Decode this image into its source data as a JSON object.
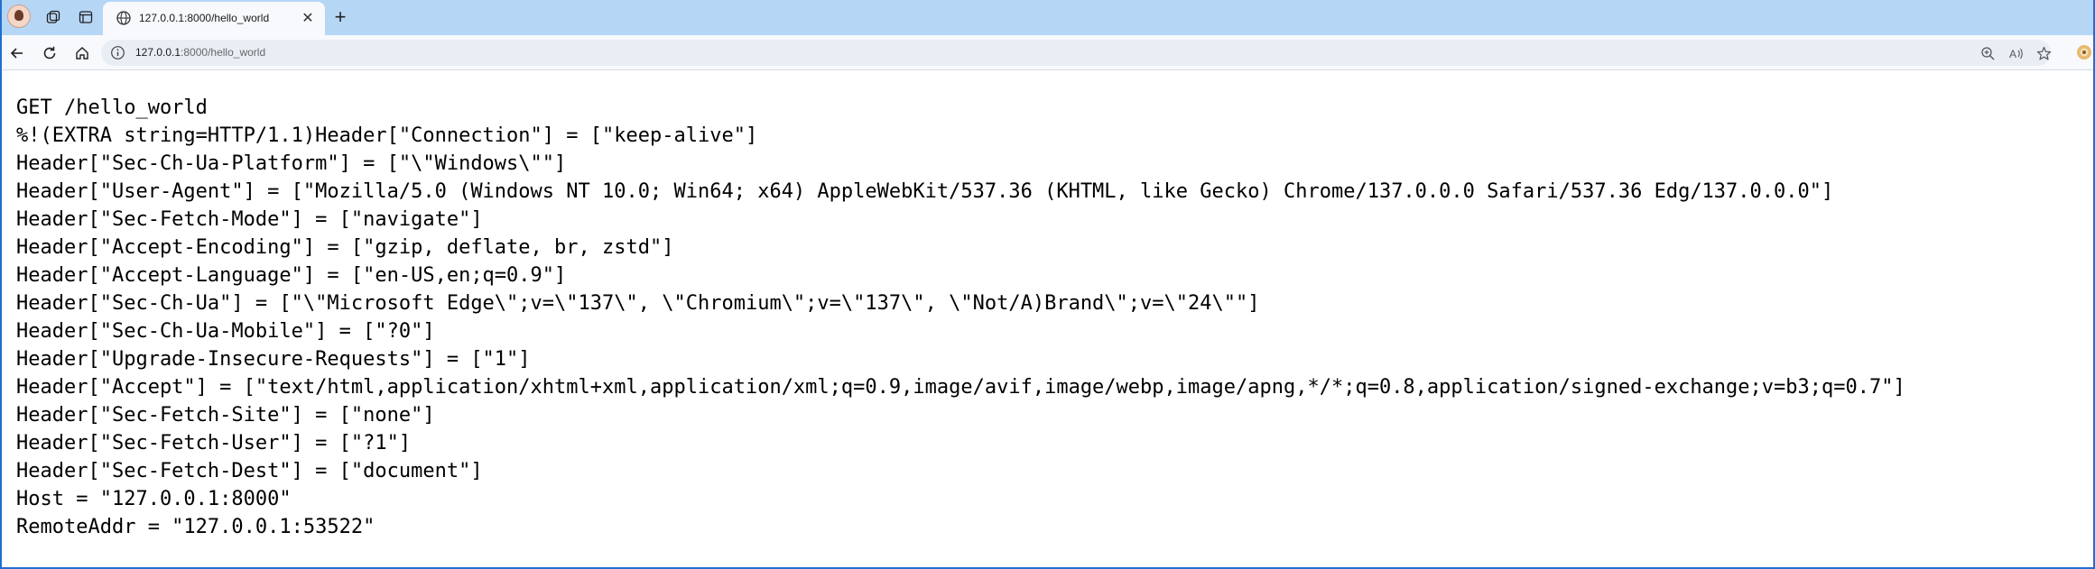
{
  "browser": {
    "tab": {
      "title": "127.0.0.1:8000/hello_world",
      "close_glyph": "✕"
    },
    "new_tab_glyph": "+",
    "address": {
      "host": "127.0.0.1",
      "path": ":8000/hello_world"
    },
    "icons": {
      "profile": "profile-avatar-icon",
      "workspaces": "workspaces-icon",
      "tab_actions": "tab-actions-icon",
      "favicon": "globe-icon",
      "back": "back-arrow-icon",
      "refresh": "refresh-icon",
      "home": "home-icon",
      "info": "info-icon",
      "zoom": "zoom-icon",
      "read_aloud": "read-aloud-icon",
      "favorite": "star-icon",
      "extension": "extension-icon"
    },
    "colors": {
      "tabbar": "#b6d6f6",
      "frame": "#1f6fd1",
      "toolbar": "#f7f9fc",
      "omnibox": "#e9eef5"
    }
  },
  "page": {
    "lines": [
      "GET /hello_world",
      "%!(EXTRA string=HTTP/1.1)Header[\"Connection\"] = [\"keep-alive\"]",
      "Header[\"Sec-Ch-Ua-Platform\"] = [\"\\\"Windows\\\"\"]",
      "Header[\"User-Agent\"] = [\"Mozilla/5.0 (Windows NT 10.0; Win64; x64) AppleWebKit/537.36 (KHTML, like Gecko) Chrome/137.0.0.0 Safari/537.36 Edg/137.0.0.0\"]",
      "Header[\"Sec-Fetch-Mode\"] = [\"navigate\"]",
      "Header[\"Accept-Encoding\"] = [\"gzip, deflate, br, zstd\"]",
      "Header[\"Accept-Language\"] = [\"en-US,en;q=0.9\"]",
      "Header[\"Sec-Ch-Ua\"] = [\"\\\"Microsoft Edge\\\";v=\\\"137\\\", \\\"Chromium\\\";v=\\\"137\\\", \\\"Not/A)Brand\\\";v=\\\"24\\\"\"]",
      "Header[\"Sec-Ch-Ua-Mobile\"] = [\"?0\"]",
      "Header[\"Upgrade-Insecure-Requests\"] = [\"1\"]",
      "Header[\"Accept\"] = [\"text/html,application/xhtml+xml,application/xml;q=0.9,image/avif,image/webp,image/apng,*/*;q=0.8,application/signed-exchange;v=b3;q=0.7\"]",
      "Header[\"Sec-Fetch-Site\"] = [\"none\"]",
      "Header[\"Sec-Fetch-User\"] = [\"?1\"]",
      "Header[\"Sec-Fetch-Dest\"] = [\"document\"]",
      "Host = \"127.0.0.1:8000\"",
      "RemoteAddr = \"127.0.0.1:53522\""
    ]
  }
}
